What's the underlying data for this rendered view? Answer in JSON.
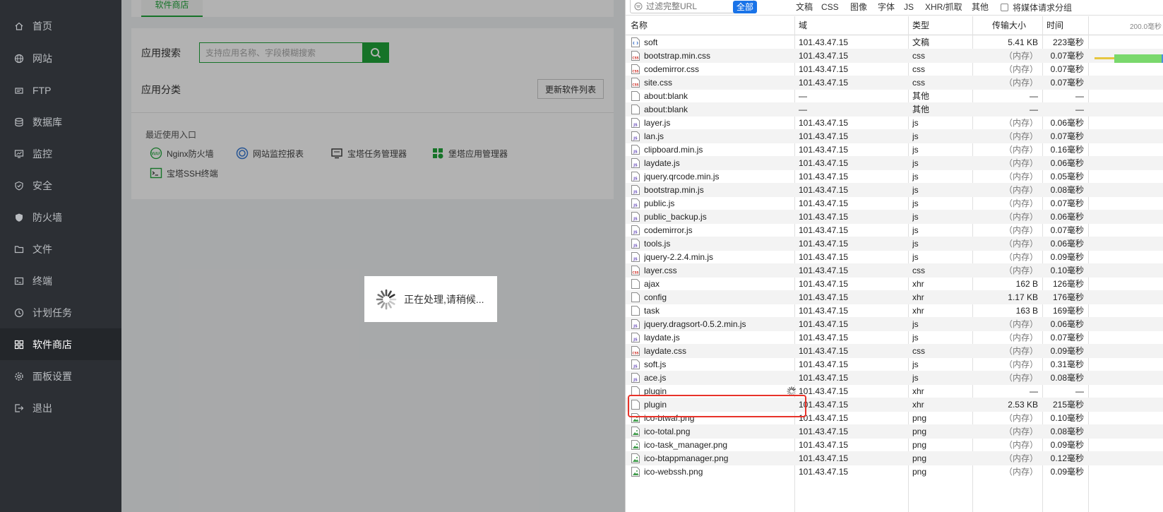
{
  "sidebar": {
    "items": [
      {
        "label": "首页",
        "icon": "home-icon"
      },
      {
        "label": "网站",
        "icon": "globe-icon"
      },
      {
        "label": "FTP",
        "icon": "ftp-icon"
      },
      {
        "label": "数据库",
        "icon": "database-icon"
      },
      {
        "label": "监控",
        "icon": "monitor-icon"
      },
      {
        "label": "安全",
        "icon": "shield-icon"
      },
      {
        "label": "防火墙",
        "icon": "firewall-icon"
      },
      {
        "label": "文件",
        "icon": "folder-icon"
      },
      {
        "label": "终端",
        "icon": "terminal-icon"
      },
      {
        "label": "计划任务",
        "icon": "clock-icon"
      },
      {
        "label": "软件商店",
        "icon": "apps-icon",
        "active": true
      },
      {
        "label": "面板设置",
        "icon": "gear-icon"
      },
      {
        "label": "退出",
        "icon": "logout-icon"
      }
    ]
  },
  "main": {
    "tab_label": "软件商店",
    "search_label": "应用搜索",
    "search_placeholder": "支持应用名称、字段模糊搜索",
    "category_label": "应用分类",
    "update_button": "更新软件列表",
    "recent_title": "最近使用入口",
    "recent_items": [
      {
        "label": "Nginx防火墙",
        "icon": "waf-icon"
      },
      {
        "label": "网站监控报表",
        "icon": "report-icon"
      },
      {
        "label": "宝塔任务管理器",
        "icon": "task-manager-icon"
      },
      {
        "label": "堡塔应用管理器",
        "icon": "app-manager-icon"
      },
      {
        "label": "宝塔SSH终端",
        "icon": "ssh-terminal-icon"
      }
    ],
    "loading_text": "正在处理,请稍候..."
  },
  "devtools": {
    "filter_placeholder": "过滤完整URL",
    "filter_types": [
      "全部",
      "文稿",
      "CSS",
      "图像",
      "字体",
      "JS",
      "XHR/抓取",
      "其他"
    ],
    "active_filter": "全部",
    "media_group_label": "将媒体请求分组",
    "columns": {
      "name": "名称",
      "domain": "域",
      "type": "类型",
      "size": "传输大小",
      "time": "时间"
    },
    "waterfall_tick": "200.0毫秒",
    "requests": [
      {
        "name": "soft",
        "domain": "101.43.47.15",
        "type": "文稿",
        "size": "5.41 KB",
        "time": "223毫秒",
        "icon": "document-icon"
      },
      {
        "name": "bootstrap.min.css",
        "domain": "101.43.47.15",
        "type": "css",
        "size": "（内存）",
        "time": "0.07毫秒",
        "icon": "css-file-icon"
      },
      {
        "name": "codemirror.css",
        "domain": "101.43.47.15",
        "type": "css",
        "size": "（内存）",
        "time": "0.07毫秒",
        "icon": "css-file-icon"
      },
      {
        "name": "site.css",
        "domain": "101.43.47.15",
        "type": "css",
        "size": "（内存）",
        "time": "0.07毫秒",
        "icon": "css-file-icon"
      },
      {
        "name": "about:blank",
        "domain": "—",
        "type": "其他",
        "size": "—",
        "time": "—",
        "icon": "blank-file-icon"
      },
      {
        "name": "about:blank",
        "domain": "—",
        "type": "其他",
        "size": "—",
        "time": "—",
        "icon": "blank-file-icon"
      },
      {
        "name": "layer.js",
        "domain": "101.43.47.15",
        "type": "js",
        "size": "（内存）",
        "time": "0.06毫秒",
        "icon": "js-file-icon"
      },
      {
        "name": "lan.js",
        "domain": "101.43.47.15",
        "type": "js",
        "size": "（内存）",
        "time": "0.07毫秒",
        "icon": "js-file-icon"
      },
      {
        "name": "clipboard.min.js",
        "domain": "101.43.47.15",
        "type": "js",
        "size": "（内存）",
        "time": "0.16毫秒",
        "icon": "js-file-icon"
      },
      {
        "name": "laydate.js",
        "domain": "101.43.47.15",
        "type": "js",
        "size": "（内存）",
        "time": "0.06毫秒",
        "icon": "js-file-icon"
      },
      {
        "name": "jquery.qrcode.min.js",
        "domain": "101.43.47.15",
        "type": "js",
        "size": "（内存）",
        "time": "0.05毫秒",
        "icon": "js-file-icon"
      },
      {
        "name": "bootstrap.min.js",
        "domain": "101.43.47.15",
        "type": "js",
        "size": "（内存）",
        "time": "0.08毫秒",
        "icon": "js-file-icon"
      },
      {
        "name": "public.js",
        "domain": "101.43.47.15",
        "type": "js",
        "size": "（内存）",
        "time": "0.07毫秒",
        "icon": "js-file-icon"
      },
      {
        "name": "public_backup.js",
        "domain": "101.43.47.15",
        "type": "js",
        "size": "（内存）",
        "time": "0.06毫秒",
        "icon": "js-file-icon"
      },
      {
        "name": "codemirror.js",
        "domain": "101.43.47.15",
        "type": "js",
        "size": "（内存）",
        "time": "0.07毫秒",
        "icon": "js-file-icon"
      },
      {
        "name": "tools.js",
        "domain": "101.43.47.15",
        "type": "js",
        "size": "（内存）",
        "time": "0.06毫秒",
        "icon": "js-file-icon"
      },
      {
        "name": "jquery-2.2.4.min.js",
        "domain": "101.43.47.15",
        "type": "js",
        "size": "（内存）",
        "time": "0.09毫秒",
        "icon": "js-file-icon"
      },
      {
        "name": "layer.css",
        "domain": "101.43.47.15",
        "type": "css",
        "size": "（内存）",
        "time": "0.10毫秒",
        "icon": "css-file-icon"
      },
      {
        "name": "ajax",
        "domain": "101.43.47.15",
        "type": "xhr",
        "size": "162 B",
        "time": "126毫秒",
        "icon": "blank-file-icon"
      },
      {
        "name": "config",
        "domain": "101.43.47.15",
        "type": "xhr",
        "size": "1.17 KB",
        "time": "176毫秒",
        "icon": "blank-file-icon"
      },
      {
        "name": "task",
        "domain": "101.43.47.15",
        "type": "xhr",
        "size": "163 B",
        "time": "169毫秒",
        "icon": "blank-file-icon"
      },
      {
        "name": "jquery.dragsort-0.5.2.min.js",
        "domain": "101.43.47.15",
        "type": "js",
        "size": "（内存）",
        "time": "0.06毫秒",
        "icon": "js-file-icon"
      },
      {
        "name": "laydate.js",
        "domain": "101.43.47.15",
        "type": "js",
        "size": "（内存）",
        "time": "0.07毫秒",
        "icon": "js-file-icon"
      },
      {
        "name": "laydate.css",
        "domain": "101.43.47.15",
        "type": "css",
        "size": "（内存）",
        "time": "0.09毫秒",
        "icon": "css-file-icon"
      },
      {
        "name": "soft.js",
        "domain": "101.43.47.15",
        "type": "js",
        "size": "（内存）",
        "time": "0.31毫秒",
        "icon": "js-file-icon"
      },
      {
        "name": "ace.js",
        "domain": "101.43.47.15",
        "type": "js",
        "size": "（内存）",
        "time": "0.08毫秒",
        "icon": "js-file-icon"
      },
      {
        "name": "plugin",
        "domain": "101.43.47.15",
        "type": "xhr",
        "size": "—",
        "time": "—",
        "icon": "blank-file-icon",
        "pending": true
      },
      {
        "name": "plugin",
        "domain": "101.43.47.15",
        "type": "xhr",
        "size": "2.53 KB",
        "time": "215毫秒",
        "icon": "blank-file-icon"
      },
      {
        "name": "ico-btwaf.png",
        "domain": "101.43.47.15",
        "type": "png",
        "size": "（内存）",
        "time": "0.10毫秒",
        "icon": "image-file-icon"
      },
      {
        "name": "ico-total.png",
        "domain": "101.43.47.15",
        "type": "png",
        "size": "（内存）",
        "time": "0.08毫秒",
        "icon": "image-file-icon"
      },
      {
        "name": "ico-task_manager.png",
        "domain": "101.43.47.15",
        "type": "png",
        "size": "（内存）",
        "time": "0.09毫秒",
        "icon": "image-file-icon"
      },
      {
        "name": "ico-btappmanager.png",
        "domain": "101.43.47.15",
        "type": "png",
        "size": "（内存）",
        "time": "0.12毫秒",
        "icon": "image-file-icon"
      },
      {
        "name": "ico-webssh.png",
        "domain": "101.43.47.15",
        "type": "png",
        "size": "（内存）",
        "time": "0.09毫秒",
        "icon": "image-file-icon"
      }
    ]
  },
  "colors": {
    "accent": "#20a53a",
    "sidebar_bg": "#2c2f34",
    "highlight": "#e8332a",
    "devtools_active": "#1a73e8"
  }
}
